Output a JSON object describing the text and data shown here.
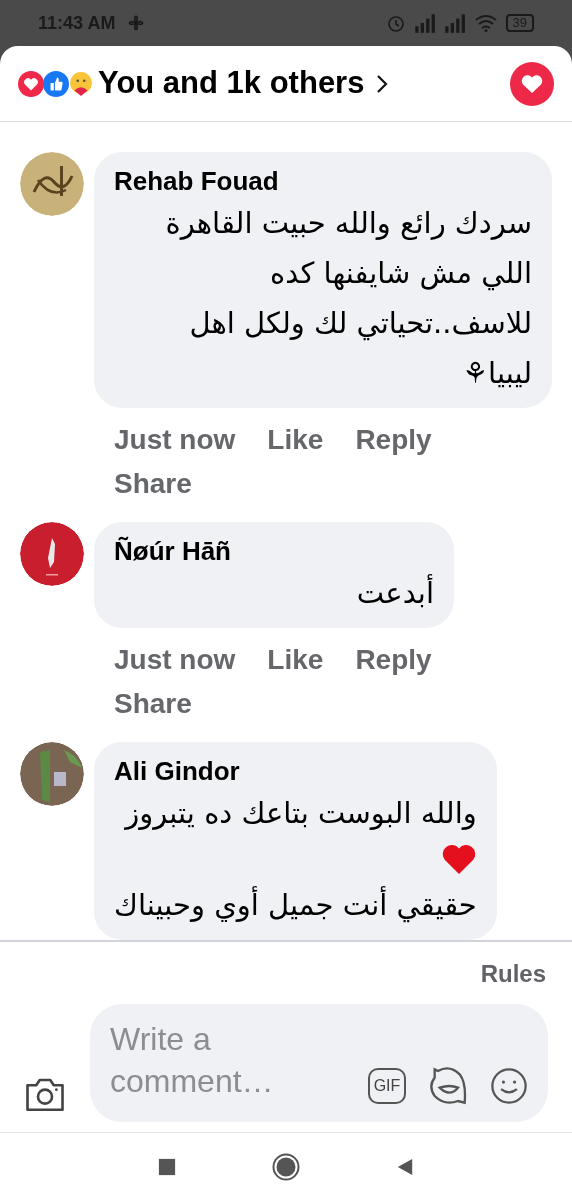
{
  "status_bar": {
    "time": "11:43 AM",
    "battery": "39"
  },
  "header": {
    "title": "You and 1k others"
  },
  "comments": [
    {
      "author": "Rehab Fouad",
      "body": [
        {
          "kind": "text",
          "text": "سردك رائع والله حبيت القاهرة اللي مش شايفنها كده للاسف..تحياتي لك ولكل اهل ليبيا⚘"
        }
      ],
      "actions": [
        "Just now",
        "Like",
        "Reply",
        "Share"
      ]
    },
    {
      "author": "Ñøúr Hāñ",
      "body": [
        {
          "kind": "text",
          "text": "أبدعت"
        }
      ],
      "actions": [
        "Just now",
        "Like",
        "Reply",
        "Share"
      ]
    },
    {
      "author": "Ali Gindor",
      "body": [
        {
          "kind": "text",
          "text": "والله البوست بتاعك ده يتبروز"
        },
        {
          "kind": "heart"
        },
        {
          "kind": "text",
          "text": "حقيقي أنت جميل أوي وحبيناك"
        }
      ]
    }
  ],
  "rules_link": "Rules",
  "composer": {
    "placeholder": "Write a comment…",
    "gif": "GIF"
  }
}
